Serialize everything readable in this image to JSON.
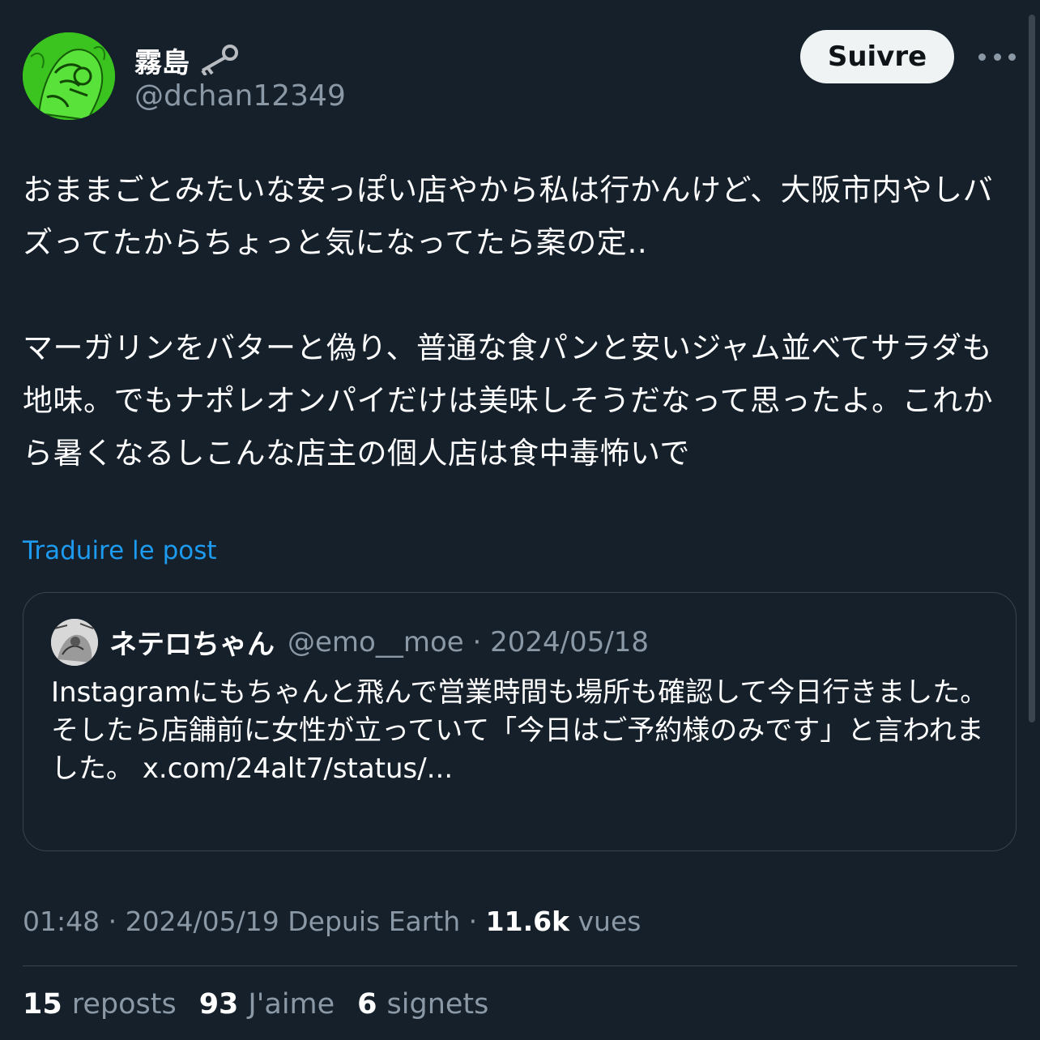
{
  "author": {
    "display_name": "霧島",
    "handle": "@dchan12349"
  },
  "follow_button_label": "Suivre",
  "post": {
    "paragraph1": "おままごとみたいな安っぽい店やから私は行かんけど、大阪市内やしバズってたからちょっと気になってたら案の定‥",
    "paragraph2": "マーガリンをバターと偽り、普通な食パンと安いジャム並べてサラダも地味。でもナポレオンパイだけは美味しそうだなって思ったよ。これから暑くなるしこんな店主の個人店は食中毒怖いで"
  },
  "translate_link": "Traduire le post",
  "quoted_post": {
    "display_name": "ネテロちゃん",
    "meta": "@emo__moe · 2024/05/18",
    "line1": "Instagramにもちゃんと飛んで営業時間も場所も確認して今日行きました。",
    "line2": "そしたら店舗前に女性が立っていて「今日はご予約様のみです」と言われました。",
    "link": "x.com/24alt7/status/..."
  },
  "meta": {
    "timestamp": "01:48 · 2024/05/19 Depuis Earth · ",
    "views_count": "11.6k",
    "views_label": " vues"
  },
  "stats": {
    "reposts_count": "15",
    "reposts_label": "reposts",
    "likes_count": "93",
    "likes_label": "J'aime",
    "bookmarks_count": "6",
    "bookmarks_label": "signets"
  },
  "icons": {
    "key": "key-icon",
    "more": "more-icon"
  }
}
